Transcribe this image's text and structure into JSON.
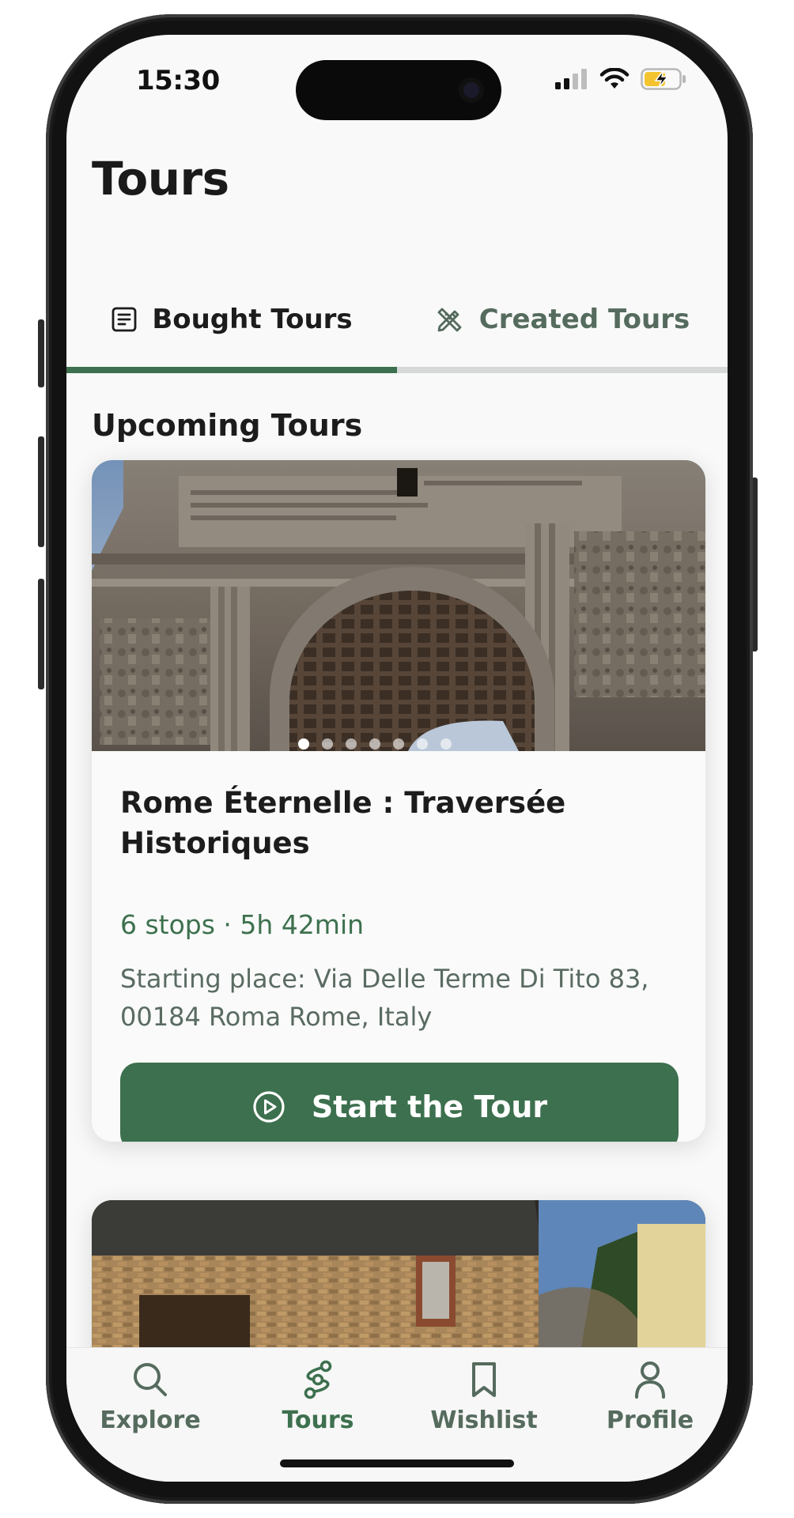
{
  "status_bar": {
    "time": "15:30"
  },
  "header": {
    "title": "Tours"
  },
  "tabs": [
    {
      "label": "Bought Tours",
      "icon": "document-list-icon",
      "active": true
    },
    {
      "label": "Created Tours",
      "icon": "pencil-ruler-icon",
      "active": false
    }
  ],
  "section": {
    "title": "Upcoming Tours"
  },
  "tour_card": {
    "title": "Rome Éternelle : Traversée Historiques",
    "meta": "6 stops · 5h 42min",
    "starting_place": "Starting place: Via Delle Terme Di Tito 83, 00184 Roma Rome, Italy",
    "button_label": "Start the Tour",
    "carousel_pages": 7,
    "carousel_active_index": 0
  },
  "bottom_nav": [
    {
      "label": "Explore",
      "icon": "search-icon",
      "active": false
    },
    {
      "label": "Tours",
      "icon": "route-icon",
      "active": true
    },
    {
      "label": "Wishlist",
      "icon": "bookmark-icon",
      "active": false
    },
    {
      "label": "Profile",
      "icon": "user-icon",
      "active": false
    }
  ],
  "colors": {
    "accent": "#3d704e",
    "muted_text": "#556b5e",
    "background": "#f8f9f8",
    "battery_charging": "#f4c430"
  }
}
